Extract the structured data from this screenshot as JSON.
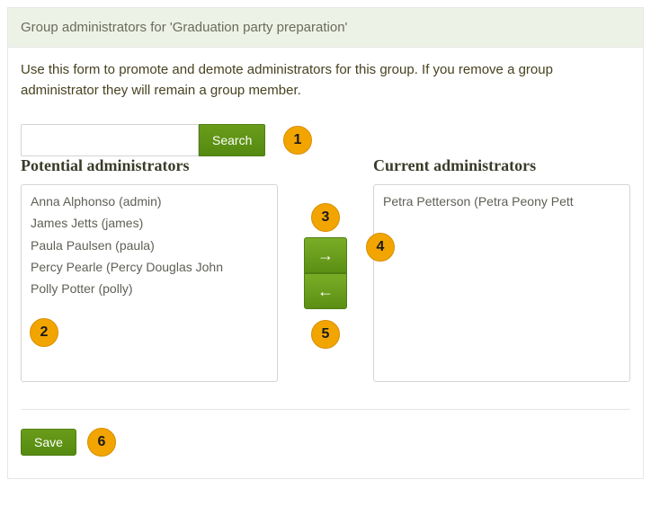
{
  "header": {
    "title": "Group administrators for 'Graduation party preparation'"
  },
  "description": "Use this form to promote and demote administrators for this group. If you remove a group administrator they will remain a group member.",
  "search": {
    "value": "",
    "button_label": "Search",
    "placeholder": ""
  },
  "potential": {
    "heading": "Potential administrators",
    "items": [
      "Anna Alphonso (admin)",
      "James Jetts (james)",
      "Paula Paulsen (paula)",
      "Percy Pearle (Percy Douglas John",
      "Polly Potter (polly)"
    ]
  },
  "current": {
    "heading": "Current administrators",
    "items": [
      "Petra Petterson (Petra Peony Pett"
    ]
  },
  "arrows": {
    "right": "→",
    "left": "←"
  },
  "save": {
    "label": "Save"
  },
  "callouts": {
    "c1": "1",
    "c2": "2",
    "c3": "3",
    "c4": "4",
    "c5": "5",
    "c6": "6"
  },
  "colors": {
    "accent": "#5b8f14",
    "header_bg": "#edf2e7",
    "callout": "#f2a500"
  }
}
